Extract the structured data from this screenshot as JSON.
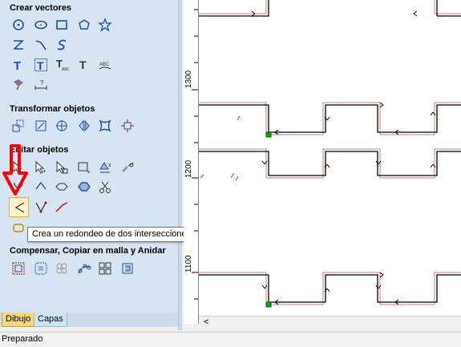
{
  "sidebar": {
    "sections": [
      {
        "title": "Crear vectores"
      },
      {
        "title": "Transformar objetos"
      },
      {
        "title": "Editar objetos"
      },
      {
        "title": "Compensar, Copiar en malla y Anidar"
      }
    ]
  },
  "tooltip": {
    "text": "Crea un redondeo de dos intersecciones"
  },
  "tabs": [
    {
      "label": "Dibujo"
    },
    {
      "label": "Capas"
    }
  ],
  "ruler": {
    "labels": [
      "1300",
      "1200",
      "1100"
    ]
  },
  "statusbar": {
    "text": "Preparado"
  },
  "colors": {
    "accent_arrow": "#ff0000",
    "sidebar_bg": "#d7e4f2",
    "node": "#00aa00"
  }
}
